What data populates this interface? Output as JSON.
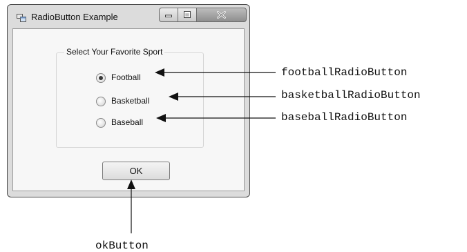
{
  "window": {
    "title": "RadioButton Example",
    "icons": [
      "app-icon",
      "minimize-icon",
      "maximize-icon",
      "close-icon"
    ]
  },
  "group": {
    "title": "Select Your Favorite Sport",
    "options": [
      {
        "label": "Football",
        "checked": true
      },
      {
        "label": "Basketball",
        "checked": false
      },
      {
        "label": "Baseball",
        "checked": false
      }
    ]
  },
  "ok_button": {
    "label": "OK"
  },
  "callouts": {
    "football": "footballRadioButton",
    "basketball": "basketballRadioButton",
    "baseball": "baseballRadioButton",
    "ok": "okButton"
  }
}
